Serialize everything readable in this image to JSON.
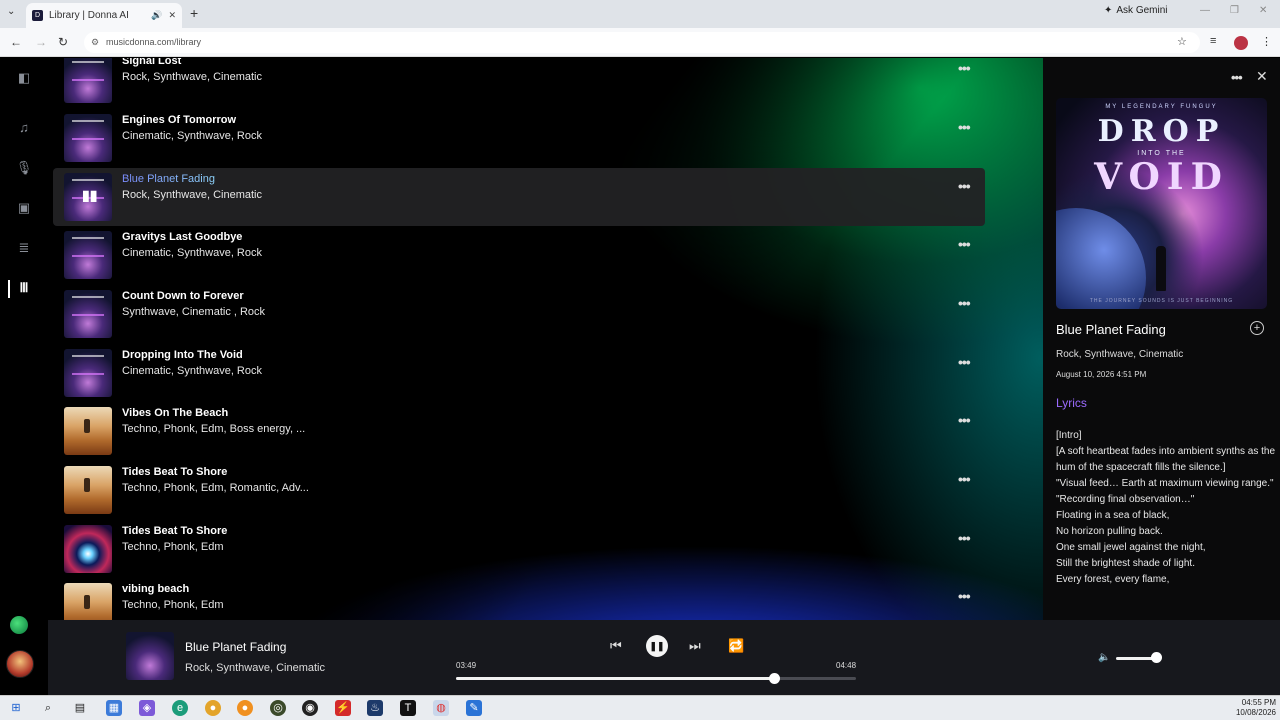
{
  "browser": {
    "tab_title": "Library | Donna AI",
    "url": "musicdonna.com/library",
    "ask_gemini": "Ask Gemini"
  },
  "library": {
    "songs": [
      {
        "title": "Signal Lost",
        "tags": "Rock, Synthwave, Cinematic",
        "art": "void"
      },
      {
        "title": "Engines Of Tomorrow",
        "tags": "Cinematic, Synthwave, Rock",
        "art": "void"
      },
      {
        "title": "Blue Planet Fading",
        "tags": "Rock, Synthwave, Cinematic",
        "art": "void",
        "selected": true
      },
      {
        "title": "Gravitys Last Goodbye",
        "tags": "Cinematic, Synthwave, Rock",
        "art": "void"
      },
      {
        "title": "Count Down to Forever",
        "tags": "Synthwave, Cinematic , Rock",
        "art": "void"
      },
      {
        "title": "Dropping Into The Void",
        "tags": "Cinematic, Synthwave, Rock",
        "art": "void"
      },
      {
        "title": "Vibes On The Beach",
        "tags": "Techno, Phonk, Edm, Boss energy, ...",
        "art": "beach"
      },
      {
        "title": "Tides Beat To Shore",
        "tags": "Techno, Phonk, Edm, Romantic, Adv...",
        "art": "beach"
      },
      {
        "title": "Tides Beat To Shore",
        "tags": "Techno, Phonk, Edm",
        "art": "portal"
      },
      {
        "title": "vibing beach",
        "tags": "Techno, Phonk, Edm",
        "art": "beach"
      }
    ]
  },
  "detail": {
    "cover_subtitle": "MY LEGENDARY FUNGUY",
    "cover_line1": "DROP",
    "cover_line2": "INTO THE",
    "cover_line3": "VOID",
    "cover_footer": "THE JOURNEY SOUNDS IS JUST BEGINNING",
    "title": "Blue Planet Fading",
    "tags": "Rock, Synthwave, Cinematic",
    "date": "August 10, 2026 4:51 PM",
    "lyrics_heading": "Lyrics",
    "lyrics": [
      "[Intro]",
      "[A soft heartbeat fades into ambient synths as the hum of the spacecraft fills the silence.]",
      "\"Visual feed… Earth at maximum viewing range.\"",
      "\"Recording final observation…\"",
      "Floating in a sea of black,",
      "No horizon pulling back.",
      "One small jewel against the night,",
      "Still the brightest shade of light.",
      "Every forest, every flame,"
    ]
  },
  "player": {
    "title": "Blue Planet Fading",
    "tags": "Rock, Synthwave, Cinematic",
    "current_time": "03:49",
    "total_time": "04:48",
    "progress": 0.795,
    "volume": 0.8
  },
  "taskbar": {
    "time": "04:55 PM",
    "date": "10/08/2026"
  }
}
